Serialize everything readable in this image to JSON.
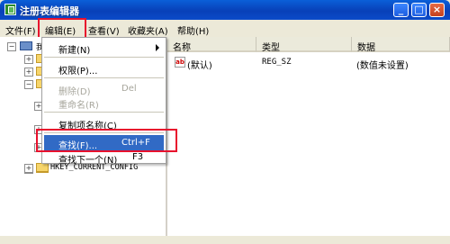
{
  "window": {
    "title": "注册表编辑器",
    "min_glyph": "_",
    "max_glyph": "□",
    "close_glyph": "×"
  },
  "menubar": {
    "items": [
      "文件(F)",
      "编辑(E)",
      "查看(V)",
      "收藏夹(A)",
      "帮助(H)"
    ]
  },
  "tree": {
    "root_label": "我",
    "expand_glyph": "+",
    "last_key": "HKEY_CURRENT_CONFIG"
  },
  "list": {
    "columns": [
      "名称",
      "类型",
      "数据"
    ],
    "rows": [
      {
        "name": "(默认)",
        "type": "REG_SZ",
        "data": "(数值未设置)",
        "icon": "string-value-icon",
        "icon_text": "ab"
      }
    ]
  },
  "edit_menu": {
    "items": [
      {
        "label": "新建(N)",
        "shortcut": "",
        "submenu": true,
        "disabled": false
      },
      {
        "label": "权限(P)...",
        "shortcut": "",
        "disabled": false
      },
      {
        "label": "删除(D)",
        "shortcut": "Del",
        "disabled": true
      },
      {
        "label": "重命名(R)",
        "shortcut": "",
        "disabled": true
      },
      {
        "label": "复制项名称(C)",
        "shortcut": "",
        "disabled": false
      },
      {
        "label": "查找(F)...",
        "shortcut": "Ctrl+F",
        "disabled": false,
        "selected": true
      },
      {
        "label": "查找下一个(N)",
        "shortcut": "F3",
        "disabled": false
      }
    ]
  },
  "colors": {
    "highlight_box": "#e8112d",
    "menu_selected": "#316ac5",
    "titlebar": "#0a5fd8"
  }
}
